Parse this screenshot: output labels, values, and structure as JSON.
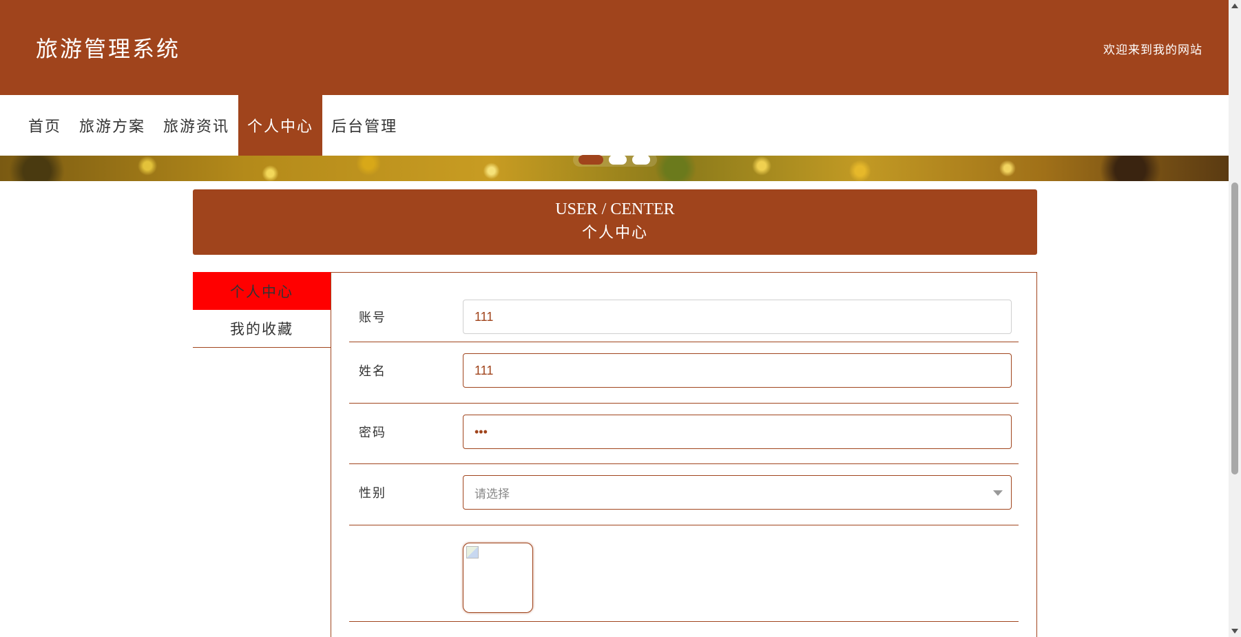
{
  "header": {
    "site_title": "旅游管理系统",
    "welcome": "欢迎来到我的网站"
  },
  "nav": {
    "items": [
      {
        "label": "首页"
      },
      {
        "label": "旅游方案"
      },
      {
        "label": "旅游资讯"
      },
      {
        "label": "个人中心",
        "active": true
      },
      {
        "label": "后台管理"
      }
    ]
  },
  "banner": {
    "slide_count": 3,
    "active_slide": 1
  },
  "title_box": {
    "en": "USER / CENTER",
    "cn": "个人中心"
  },
  "side_menu": {
    "items": [
      {
        "label": "个人中心",
        "active": true
      },
      {
        "label": "我的收藏"
      }
    ]
  },
  "form": {
    "account": {
      "label": "账号",
      "value": "111"
    },
    "name": {
      "label": "姓名",
      "value": "111"
    },
    "password": {
      "label": "密码",
      "value": "•••"
    },
    "gender": {
      "label": "性别",
      "placeholder": "请选择"
    }
  },
  "colors": {
    "brand": "#a0441c",
    "active_side": "#ff0000"
  }
}
